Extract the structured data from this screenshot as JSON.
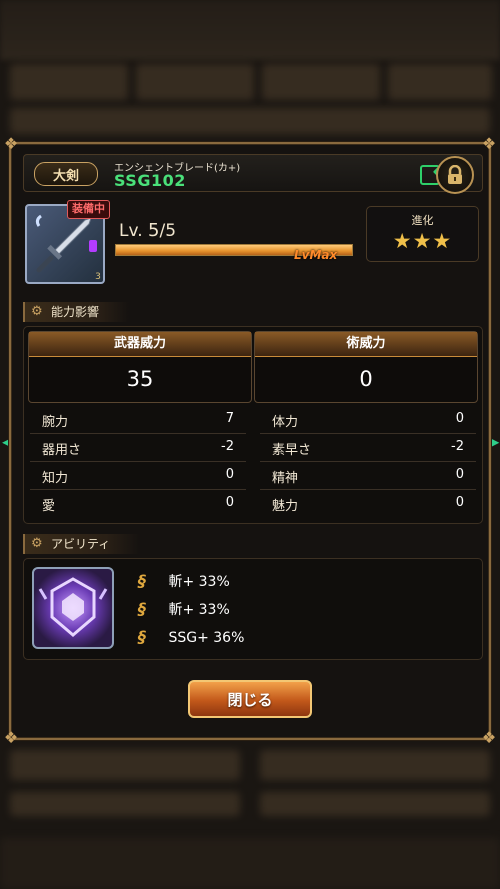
{
  "dialog": {
    "weapon_type": "大剣",
    "weapon_subtitle": "エンシェントブレード(カ+)",
    "weapon_name": "SSG102",
    "equipped_label": "装備中",
    "rarity_number": "3",
    "level_label": "Lv.",
    "level_current": "5",
    "level_max": "/5",
    "exp_fraction": 1.0,
    "lvmax_label": "LvMax",
    "evolution_label": "進化",
    "evolution_stars": "★★★",
    "evolution_value": 3
  },
  "sections": {
    "ability_effect": "能力影響",
    "abilities": "アビリティ"
  },
  "power": {
    "weapon": {
      "label": "武器威力",
      "value": "35"
    },
    "magic": {
      "label": "術威力",
      "value": "0"
    }
  },
  "stats": [
    {
      "left_name": "腕力",
      "left_value": "7",
      "right_name": "体力",
      "right_value": "0"
    },
    {
      "left_name": "器用さ",
      "left_value": "-2",
      "right_name": "素早さ",
      "right_value": "-2"
    },
    {
      "left_name": "知力",
      "left_value": "0",
      "right_name": "精神",
      "right_value": "0"
    },
    {
      "left_name": "愛",
      "left_value": "0",
      "right_name": "魅力",
      "right_value": "0"
    }
  ],
  "abilities": [
    {
      "glyph": "§",
      "text": "斬+ 33%"
    },
    {
      "glyph": "§",
      "text": "斬+ 33%"
    },
    {
      "glyph": "§",
      "text": "SSG+ 36%"
    }
  ],
  "buttons": {
    "close": "閉じる"
  },
  "colors": {
    "accent_gold": "#c9a263",
    "weapon_name_green": "#4ae07a",
    "close_orange": "#e07a2a",
    "equipped_red": "#ff6b6b"
  },
  "icons": {
    "edit": "edit-icon",
    "lock": "lock-icon",
    "weapon": "sword-icon",
    "ability": "crest-icon",
    "left_nav": "chevron-left-icon",
    "right_nav": "chevron-right-icon"
  }
}
